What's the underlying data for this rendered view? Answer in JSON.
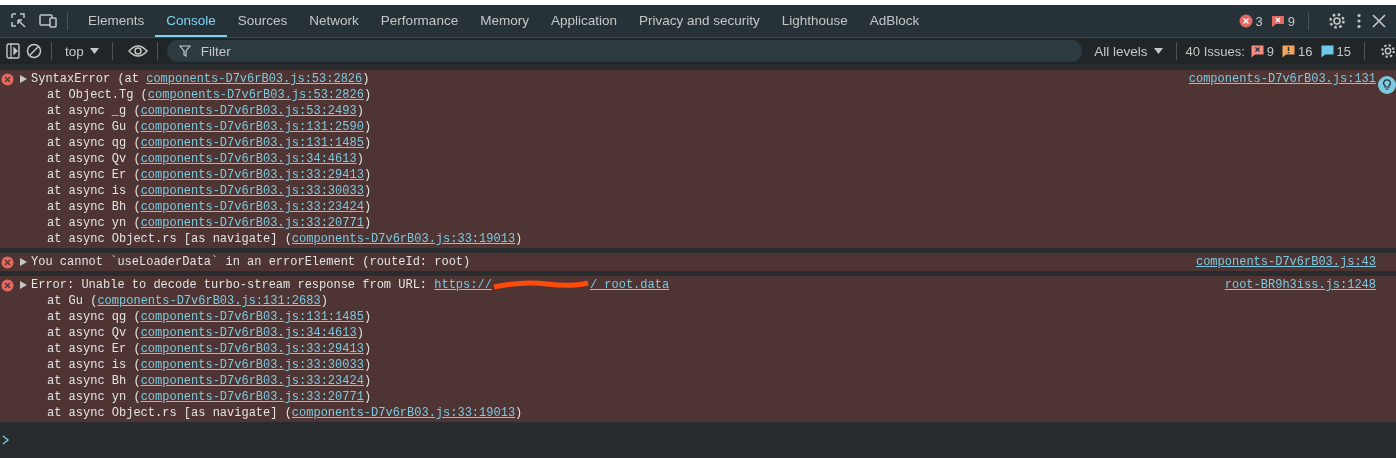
{
  "tabs": [
    {
      "label": "Elements",
      "selected": false
    },
    {
      "label": "Console",
      "selected": true
    },
    {
      "label": "Sources",
      "selected": false
    },
    {
      "label": "Network",
      "selected": false
    },
    {
      "label": "Performance",
      "selected": false
    },
    {
      "label": "Memory",
      "selected": false
    },
    {
      "label": "Application",
      "selected": false
    },
    {
      "label": "Privacy and security",
      "selected": false
    },
    {
      "label": "Lighthouse",
      "selected": false
    },
    {
      "label": "AdBlock",
      "selected": false
    }
  ],
  "counters": {
    "errors": "3",
    "messages": "9"
  },
  "toolbar": {
    "context": "top",
    "filter_placeholder": "Filter",
    "levels": "All levels",
    "issues_label": "40 Issues:",
    "issues": [
      {
        "kind": "error",
        "count": "9"
      },
      {
        "kind": "warning",
        "count": "16"
      },
      {
        "kind": "info",
        "count": "15"
      }
    ]
  },
  "messages": [
    {
      "kind": "error",
      "expanded": false,
      "head": {
        "text": "SyntaxError (at ",
        "link": "components-D7v6rB03.js:53:2826",
        "suffix": ")"
      },
      "source": "components-D7v6rB03.js:131",
      "stack": [
        {
          "prefix": "at Object.Tg (",
          "link": "components-D7v6rB03.js:53:2826",
          "suffix": ")"
        },
        {
          "prefix": "at async _g (",
          "link": "components-D7v6rB03.js:53:2493",
          "suffix": ")"
        },
        {
          "prefix": "at async Gu (",
          "link": "components-D7v6rB03.js:131:2590",
          "suffix": ")"
        },
        {
          "prefix": "at async qg (",
          "link": "components-D7v6rB03.js:131:1485",
          "suffix": ")"
        },
        {
          "prefix": "at async Qv (",
          "link": "components-D7v6rB03.js:34:4613",
          "suffix": ")"
        },
        {
          "prefix": "at async Er (",
          "link": "components-D7v6rB03.js:33:29413",
          "suffix": ")"
        },
        {
          "prefix": "at async is (",
          "link": "components-D7v6rB03.js:33:30033",
          "suffix": ")"
        },
        {
          "prefix": "at async Bh (",
          "link": "components-D7v6rB03.js:33:23424",
          "suffix": ")"
        },
        {
          "prefix": "at async yn (",
          "link": "components-D7v6rB03.js:33:20771",
          "suffix": ")"
        },
        {
          "prefix": "at async Object.rs [as navigate] (",
          "link": "components-D7v6rB03.js:33:19013",
          "suffix": ")"
        }
      ]
    },
    {
      "kind": "error",
      "expanded": false,
      "head": {
        "text": "You cannot `useLoaderData` in an errorElement (routeId: root)"
      },
      "source": "components-D7v6rB03.js:43"
    },
    {
      "kind": "error",
      "expanded": false,
      "head": {
        "text": "Error: Unable to decode turbo-stream response from URL: ",
        "link": "https://",
        "redacted": true,
        "link_end": "/_root.data"
      },
      "source": "root-BR9h3iss.js:1248",
      "stack": [
        {
          "prefix": "at Gu (",
          "link": "components-D7v6rB03.js:131:2683",
          "suffix": ")"
        },
        {
          "prefix": "at async qg (",
          "link": "components-D7v6rB03.js:131:1485",
          "suffix": ")"
        },
        {
          "prefix": "at async Qv (",
          "link": "components-D7v6rB03.js:34:4613",
          "suffix": ")"
        },
        {
          "prefix": "at async Er (",
          "link": "components-D7v6rB03.js:33:29413",
          "suffix": ")"
        },
        {
          "prefix": "at async is (",
          "link": "components-D7v6rB03.js:33:30033",
          "suffix": ")"
        },
        {
          "prefix": "at async Bh (",
          "link": "components-D7v6rB03.js:33:23424",
          "suffix": ")"
        },
        {
          "prefix": "at async yn (",
          "link": "components-D7v6rB03.js:33:20771",
          "suffix": ")"
        },
        {
          "prefix": "at async Object.rs [as navigate] (",
          "link": "components-D7v6rB03.js:33:19013",
          "suffix": ")"
        }
      ]
    }
  ]
}
